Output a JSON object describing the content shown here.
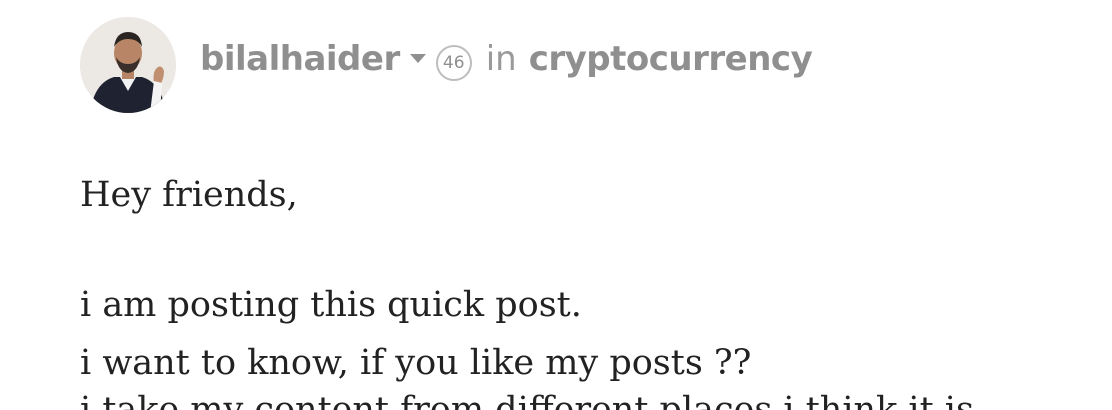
{
  "post": {
    "author": "bilalhaider",
    "reputation": "46",
    "in_label": "in",
    "community": "cryptocurrency",
    "body": {
      "greeting": "Hey friends,",
      "line1": "i am posting this quick post.",
      "line2": "i want to know, if you like my posts ??",
      "line3_partial": "i take my content from different places i think it is"
    }
  },
  "icons": {
    "caret": "chevron-down-icon"
  },
  "colors": {
    "meta_text": "#8f8f8f",
    "body_text": "#222222",
    "background": "#ffffff"
  }
}
